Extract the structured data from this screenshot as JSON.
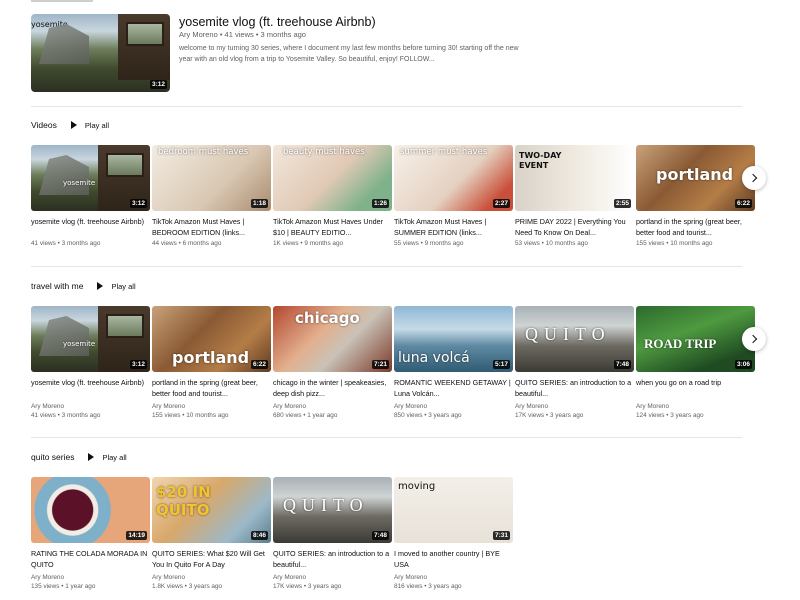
{
  "featured": {
    "title": "yosemite vlog (ft. treehouse Airbnb)",
    "meta": "Ary Moreno • 41 views • 3 months ago",
    "description": "welcome to my turning 30 series, where I document my last few months before turning 30! starting off the new year with an old vlog from a trip to Yosemite Valley. So beautiful, enjoy! FOLLOW...",
    "duration": "3:12",
    "overlay": "yosemite"
  },
  "play_all_label": "Play all",
  "shelves": [
    {
      "title": "Videos",
      "videos": [
        {
          "title": "yosemite vlog (ft. treehouse Airbnb)",
          "channel": "",
          "meta": "41 views • 3 months ago",
          "duration": "3:12",
          "overlay": "yosemite"
        },
        {
          "title": "TikTok Amazon Must Haves | BEDROOM EDITION (links...",
          "channel": "",
          "meta": "44 views • 6 months ago",
          "duration": "1:18",
          "overlay": "bedroom must haves"
        },
        {
          "title": "TikTok Amazon Must Haves Under $10 | BEAUTY EDITIO...",
          "channel": "",
          "meta": "1K views • 9 months ago",
          "duration": "1:26",
          "overlay": "beauty must haves"
        },
        {
          "title": "TikTok Amazon Must Haves | SUMMER EDITION (links...",
          "channel": "",
          "meta": "55 views • 9 months ago",
          "duration": "2:27",
          "overlay": "summer must haves"
        },
        {
          "title": "PRIME DAY 2022 | Everything You Need To Know On Deal...",
          "channel": "",
          "meta": "53 views • 10 months ago",
          "duration": "2:55",
          "overlay": "TWO-DAY EVENT"
        },
        {
          "title": "portland in the spring (great beer, better food and tourist...",
          "channel": "",
          "meta": "155 views • 10 months ago",
          "duration": "6:22",
          "overlay": "portland"
        }
      ]
    },
    {
      "title": "travel with me",
      "videos": [
        {
          "title": "yosemite vlog (ft. treehouse Airbnb)",
          "channel": "Ary Moreno",
          "meta": "41 views • 3 months ago",
          "duration": "3:12",
          "overlay": "yosemite"
        },
        {
          "title": "portland in the spring (great beer, better food and tourist...",
          "channel": "Ary Moreno",
          "meta": "155 views • 10 months ago",
          "duration": "6:22",
          "overlay": "portland"
        },
        {
          "title": "chicago in the winter | speakeasies, deep dish pizz...",
          "channel": "Ary Moreno",
          "meta": "680 views • 1 year ago",
          "duration": "7:21",
          "overlay": "chicago"
        },
        {
          "title": "ROMANTIC WEEKEND GETAWAY | Luna Volcán...",
          "channel": "Ary Moreno",
          "meta": "850 views • 3 years ago",
          "duration": "5:17",
          "overlay": "luna volcá"
        },
        {
          "title": "QUITO SERIES: an introduction to a beautiful...",
          "channel": "Ary Moreno",
          "meta": "17K views • 3 years ago",
          "duration": "7:48",
          "overlay": "QUITO"
        },
        {
          "title": "when you go on a road trip",
          "channel": "Ary Moreno",
          "meta": "124 views • 3 years ago",
          "duration": "3:06",
          "overlay": "ROAD TRIP"
        }
      ]
    },
    {
      "title": "quito series",
      "videos": [
        {
          "title": "RATING THE COLADA MORADA IN QUITO",
          "channel": "Ary Moreno",
          "meta": "135 views • 1 year ago",
          "duration": "14:19",
          "overlay": ""
        },
        {
          "title": "QUITO SERIES: What $20 Will Get You In Quito For A Day",
          "channel": "Ary Moreno",
          "meta": "1.8K views • 3 years ago",
          "duration": "8:46",
          "overlay": "$20 IN QUITO"
        },
        {
          "title": "QUITO SERIES: an introduction to a beautiful...",
          "channel": "Ary Moreno",
          "meta": "17K views • 3 years ago",
          "duration": "7:48",
          "overlay": "QUITO"
        },
        {
          "title": "I moved to another country | BYE USA",
          "channel": "Ary Moreno",
          "meta": "816 views • 3 years ago",
          "duration": "7:31",
          "overlay": "moving"
        }
      ]
    }
  ],
  "icons": {
    "play": "play-icon",
    "next": "chevron-right-icon"
  }
}
